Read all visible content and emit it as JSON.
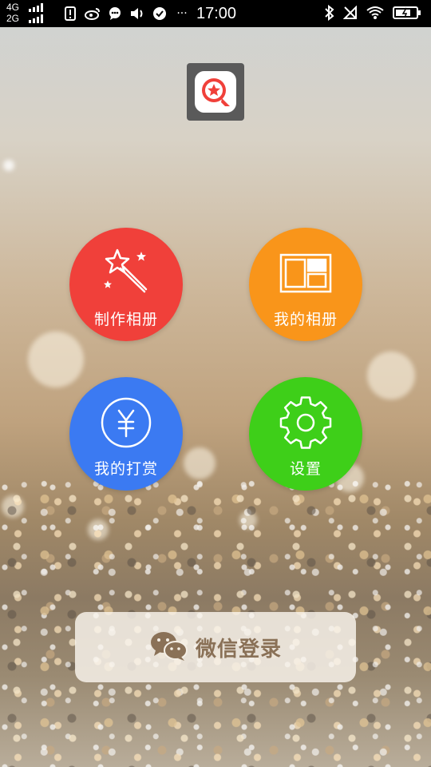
{
  "status_bar": {
    "network_top": "4G",
    "network_bottom": "2G",
    "time": "17:00",
    "more": "···"
  },
  "app": {
    "logo_icon": "star-magnifier-icon",
    "accent_red": "#f0403a",
    "accent_orange": "#f9951a",
    "accent_blue": "#3b7af2",
    "accent_green": "#3ecf19"
  },
  "menu": {
    "make_album": {
      "label": "制作相册",
      "icon": "magic-wand-icon"
    },
    "my_albums": {
      "label": "我的相册",
      "icon": "album-layout-icon"
    },
    "my_rewards": {
      "label": "我的打赏",
      "icon": "yuan-coin-icon"
    },
    "settings": {
      "label": "设置",
      "icon": "gear-icon"
    }
  },
  "login": {
    "wechat_label": "微信登录",
    "icon": "wechat-icon",
    "label_color": "#8a7157"
  }
}
